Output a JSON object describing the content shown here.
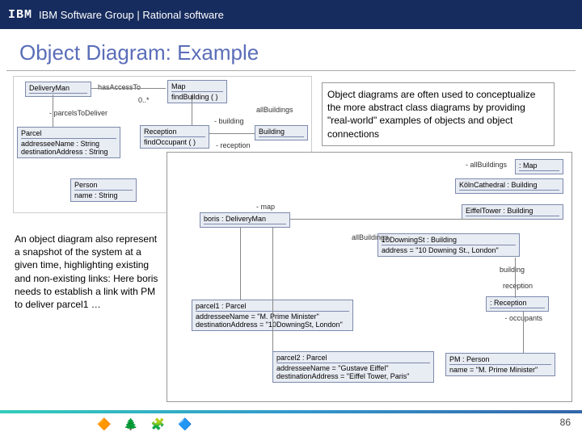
{
  "header": {
    "logo": "IBM",
    "group": "IBM Software Group | Rational software"
  },
  "title": "Object Diagram: Example",
  "desc1": "Object diagrams are often used to conceptualize the more abstract class diagrams by providing \"real-world\" examples of objects and object connections",
  "desc2": "An object diagram also represent a snapshot of the system at a given time, highlighting existing and non-existing links: Here boris needs to establish a link with PM to deliver parcel1 …",
  "upper": {
    "deliveryMan": "DeliveryMan",
    "map": "Map",
    "findBuilding": "findBuilding ( )",
    "hasAccessTo": "hasAccessTo",
    "zeroStar": "0..*",
    "parcelsToDeliver": "- parcelsToDeliver",
    "parcel": "Parcel",
    "parcelAttr1": "addresseeName : String",
    "parcelAttr2": "destinationAddress : String",
    "person": "Person",
    "personAttr": "name : String",
    "reception": "Reception",
    "receptionOp": "findOccupant ( )",
    "buildingLbl": "- building",
    "receptionLbl": "- reception",
    "building": "Building",
    "allBuildings": "allBuildings"
  },
  "lower": {
    "mapObj": ": Map",
    "allBuildings": "- allBuildings",
    "koln": "KölnCathedral : Building",
    "eiffel": "EiffelTower : Building",
    "boris": "boris : DeliveryMan",
    "mapLbl": "- map",
    "downing": "10DowningSt : Building",
    "downingAttr": "address = \"10 Downing St., London\"",
    "allBuildings2": "allBuildings",
    "buildingLbl": "building",
    "receptionLbl": "reception",
    "reception": ": Reception",
    "occupants": "- occupants",
    "parcel1": "parcel1 : Parcel",
    "p1a": "addresseeName = \"M. Prime Minister\"",
    "p1b": "destinationAddress = \"10DowningSt, London\"",
    "parcel2": "parcel2 : Parcel",
    "p2a": "addresseeName = \"Gustave Eiffel\"",
    "p2b": "destinationAddress = \"Eiffel Tower, Paris\"",
    "pm": "PM : Person",
    "pmAttr": "name = \"M. Prime Minister\""
  },
  "page": "86"
}
